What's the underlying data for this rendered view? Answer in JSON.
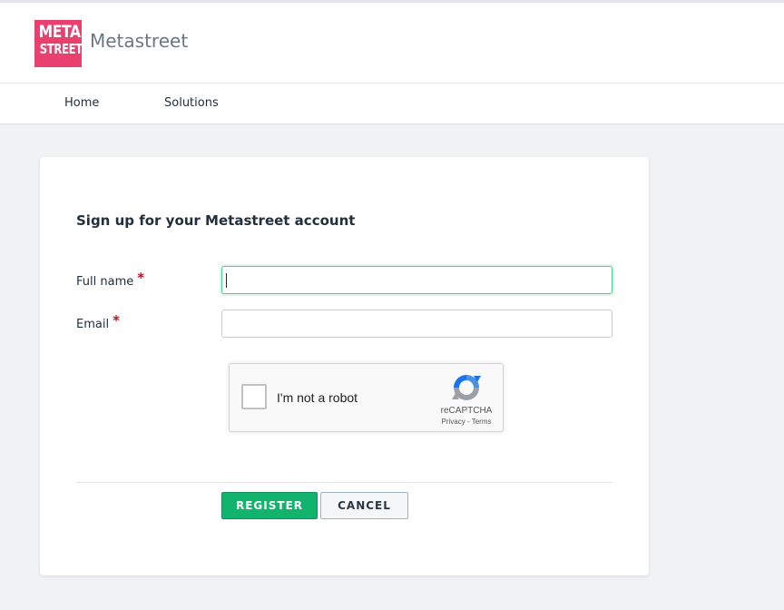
{
  "header": {
    "logo_line1": "META",
    "logo_line2": "STREET",
    "site_name": "Metastreet"
  },
  "nav": {
    "items": [
      {
        "label": "Home"
      },
      {
        "label": "Solutions"
      }
    ]
  },
  "form": {
    "title": "Sign up for your Metastreet account",
    "full_name_label": "Full name",
    "email_label": "Email",
    "required_marker": "*",
    "full_name_value": "",
    "email_value": ""
  },
  "recaptcha": {
    "checkbox_label": "I'm not a robot",
    "brand": "reCAPTCHA",
    "links": "Privacy - Terms"
  },
  "buttons": {
    "register": "REGISTER",
    "cancel": "CANCEL"
  },
  "colors": {
    "brand": "#e8406f",
    "primary": "#12b36d",
    "focus": "#4fcf8e",
    "required": "#c0121d"
  }
}
